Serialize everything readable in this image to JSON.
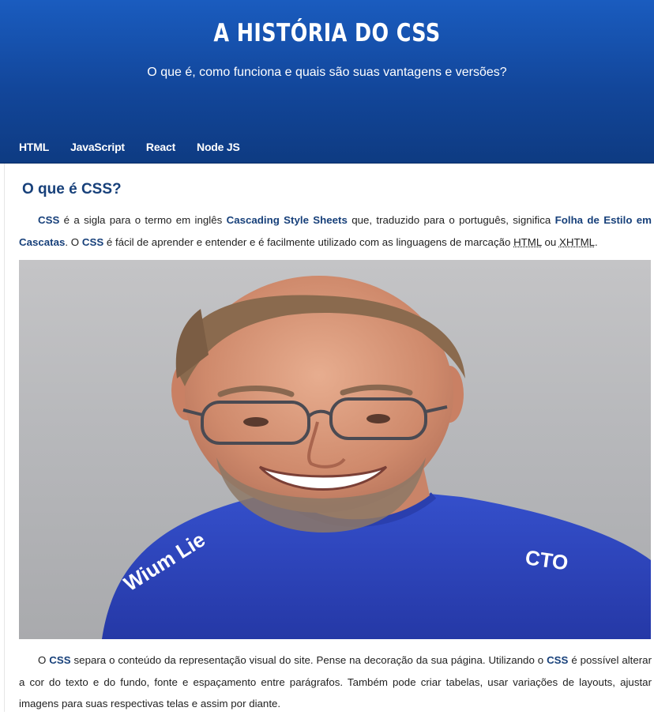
{
  "header": {
    "title": "A HISTÓRIA DO CSS",
    "subtitle": "O que é, como funciona e quais são suas vantagens e versões?"
  },
  "nav": {
    "items": [
      "HTML",
      "JavaScript",
      "React",
      "Node JS"
    ]
  },
  "section": {
    "title": "O que é CSS?"
  },
  "para1": {
    "t1": "CSS",
    "t2": " é a sigla para o termo em inglês ",
    "t3": "Cascading Style Sheets",
    "t4": " que, traduzido para o português, significa ",
    "t5": "Folha de Estilo em Cascatas",
    "t6": ". O ",
    "t7": "CSS",
    "t8": " é fácil de aprender e entender e é facilmente utilizado com as linguagens de marcação ",
    "t9": "HTML",
    "t10": " ou ",
    "t11": "XHTML",
    "t12": "."
  },
  "photo": {
    "shirt_text_left": "Wium Lie",
    "shirt_text_right": "CTO"
  },
  "para2": {
    "t1": "O ",
    "t2": "CSS",
    "t3": " separa o conteúdo da representação visual do site. Pense na decoração da sua página. Utilizando o ",
    "t4": "CSS",
    "t5": " é possível alterar a cor do texto e do fundo, fonte e espaçamento entre parágrafos. Também pode criar tabelas, usar variações de layouts, ajustar imagens para suas respectivas telas e assim por diante."
  },
  "colors": {
    "header_blue": "#12469a",
    "heading_blue": "#17407a",
    "shirt_blue": "#2f47c2"
  }
}
